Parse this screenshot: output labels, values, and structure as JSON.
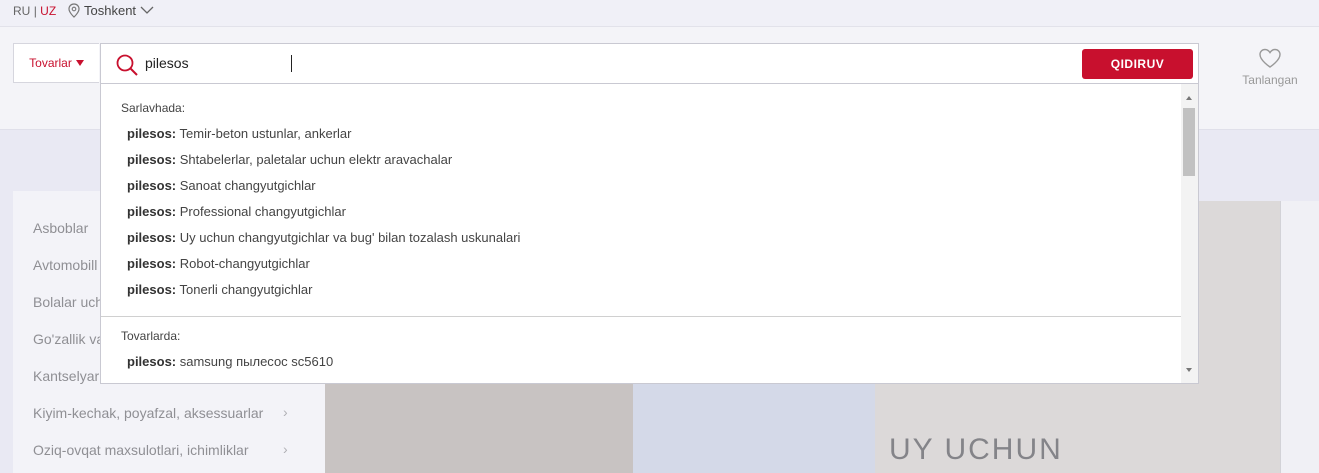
{
  "topbar": {
    "lang_ru": "RU",
    "lang_sep": "|",
    "lang_uz": "UZ",
    "city": "Toshkent"
  },
  "search": {
    "category": "Tovarlar",
    "query": "pilesos",
    "button": "QIDIRUV"
  },
  "favorites": {
    "label": "Tanlangan"
  },
  "dropdown": {
    "section1_label": "Sarlavhada:",
    "section1_items": [
      {
        "prefix": "pilesos:",
        "text": "Temir-beton ustunlar, ankerlar"
      },
      {
        "prefix": "pilesos:",
        "text": "Shtabelerlar, paletalar uchun elektr aravachalar"
      },
      {
        "prefix": "pilesos:",
        "text": "Sanoat changyutgichlar"
      },
      {
        "prefix": "pilesos:",
        "text": "Professional changyutgichlar"
      },
      {
        "prefix": "pilesos:",
        "text": "Uy uchun changyutgichlar va bug' bilan tozalash uskunalari"
      },
      {
        "prefix": "pilesos:",
        "text": "Robot-changyutgichlar"
      },
      {
        "prefix": "pilesos:",
        "text": "Tonerli changyutgichlar"
      }
    ],
    "section2_label": "Tovarlarda:",
    "section2_items": [
      {
        "prefix": "pilesos:",
        "text": "samsung пылесос sc5610"
      }
    ]
  },
  "sidebar": {
    "items": [
      {
        "label": "Asboblar"
      },
      {
        "label": "Avtomobill"
      },
      {
        "label": "Bolalar uch"
      },
      {
        "label": "Go'zallik va"
      },
      {
        "label": "Kantselyari"
      },
      {
        "label": "Kiyim-kechak, poyafzal, aksessuarlar"
      },
      {
        "label": "Oziq-ovqat maxsulotlari, ichimliklar"
      }
    ]
  },
  "banner": {
    "title": "UY UCHUN"
  },
  "colors": {
    "accent": "#c8102e"
  }
}
